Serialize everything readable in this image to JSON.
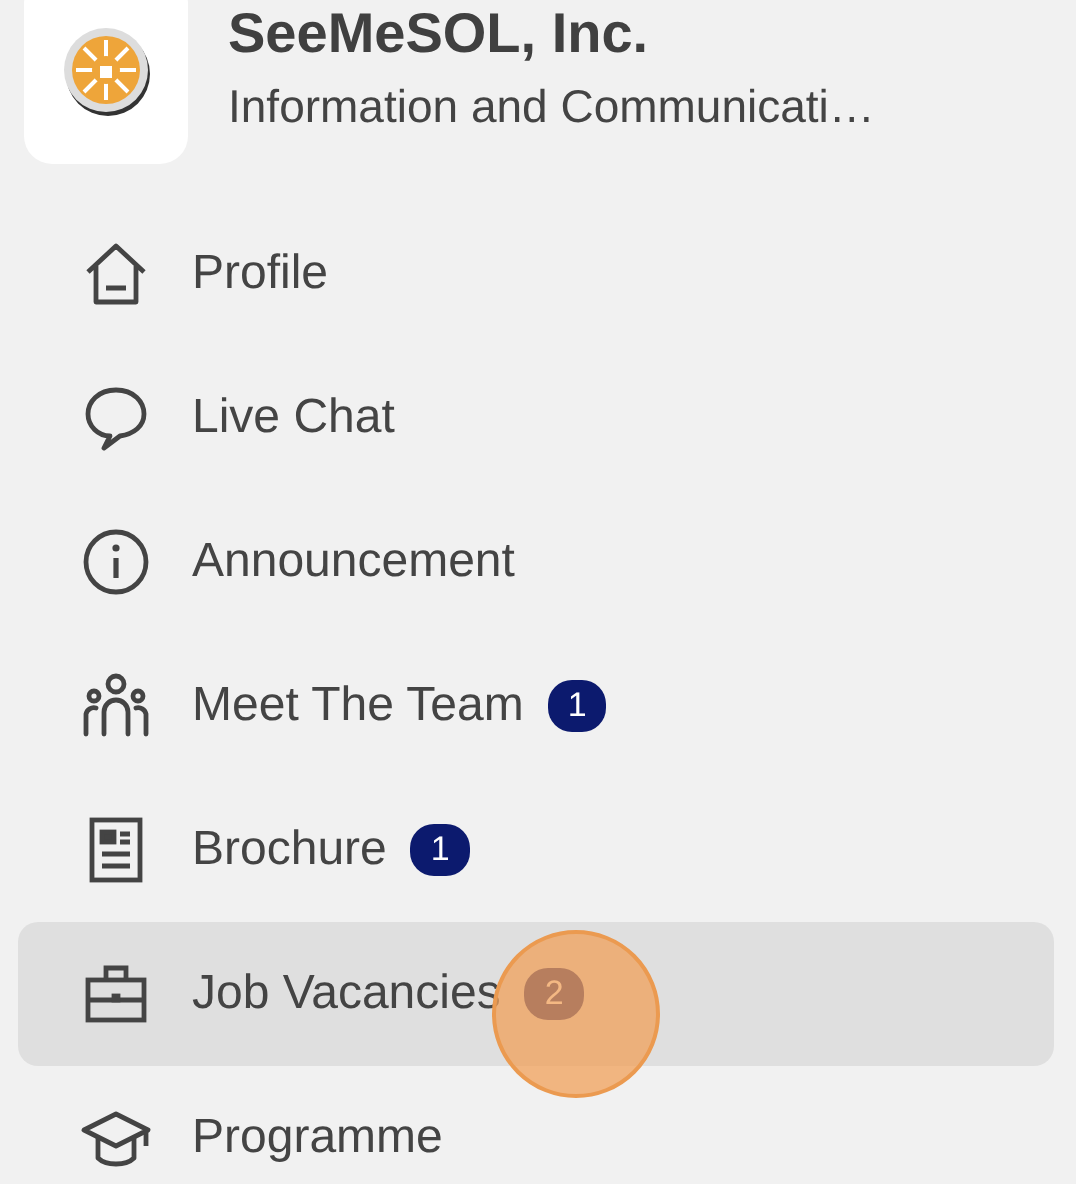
{
  "company": {
    "name": "SeeMeSOL, Inc.",
    "category": "Information and Communicati…"
  },
  "menu": [
    {
      "label": "Profile",
      "selected": false
    },
    {
      "label": "Live Chat",
      "selected": false
    },
    {
      "label": "Announcement",
      "selected": false
    },
    {
      "label": "Meet The Team",
      "selected": false,
      "badge": "1"
    },
    {
      "label": "Brochure",
      "selected": false,
      "badge": "1"
    },
    {
      "label": "Job Vacancies",
      "selected": true,
      "badge": "2"
    },
    {
      "label": "Programme",
      "selected": false
    }
  ]
}
